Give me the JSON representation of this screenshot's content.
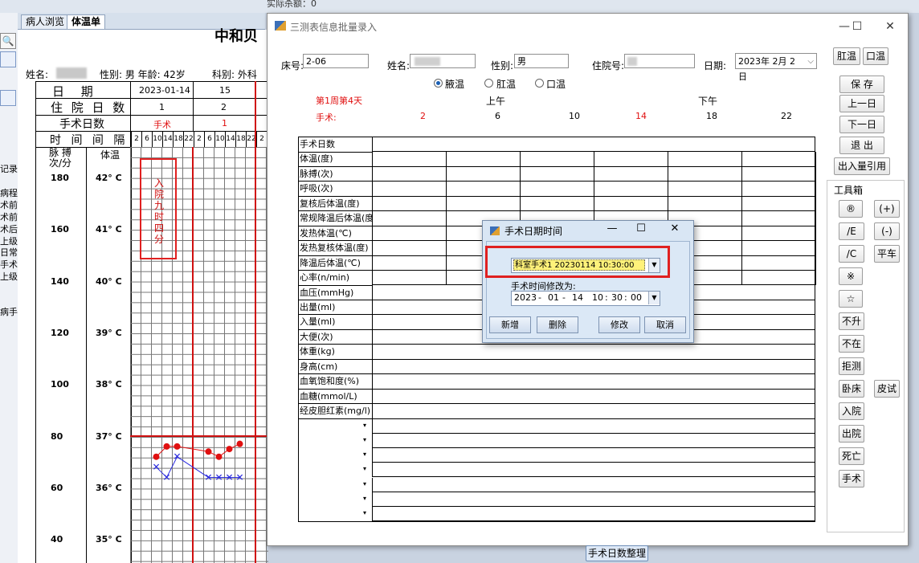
{
  "bg_app": {
    "top_text": "实际杀额：0",
    "pin_label": "中",
    "tabs": [
      "病人浏览",
      "体温单"
    ],
    "sheet_title": "中和贝",
    "left_fragments": [
      "记录",
      "病程",
      "术前",
      "术前",
      "术后",
      "上级",
      "日常",
      "手术",
      "上级",
      "病手"
    ],
    "patient": {
      "name_label": "姓名:",
      "sex_age": "性别: 男 年龄: 42岁",
      "dept": "科别: 外科"
    },
    "header_rows": {
      "date_label": "日 期",
      "date_values": [
        "2023-01-14",
        "15"
      ],
      "days_label": "住 院 日 数",
      "days_values": [
        "1",
        "2"
      ],
      "op_label": "手术日数",
      "op_values": [
        "手术",
        "1"
      ],
      "interval_label": "时 间 间 隔",
      "interval_values": [
        "2",
        "6",
        "10",
        "14",
        "18",
        "22",
        "2",
        "6",
        "10",
        "14",
        "18",
        "22",
        "2"
      ]
    },
    "axis": {
      "pulse_label": "脉 搏\n次/分",
      "temp_label": "体温",
      "pulse_ticks": [
        "180",
        "160",
        "140",
        "120",
        "100",
        "80",
        "60",
        "40"
      ],
      "temp_ticks": [
        "42° C",
        "41° C",
        "40° C",
        "39° C",
        "38° C",
        "37° C",
        "36° C",
        "35° C"
      ]
    },
    "admission_note": [
      "入",
      "院",
      "九",
      "时",
      "四",
      "分"
    ],
    "series_temp_red": [
      {
        "slot": 2,
        "value": 36.6
      },
      {
        "slot": 3,
        "value": 36.8
      },
      {
        "slot": 4,
        "value": 36.8
      },
      {
        "slot": 7,
        "value": 36.7
      },
      {
        "slot": 8,
        "value": 36.6
      },
      {
        "slot": 9,
        "value": 36.75
      },
      {
        "slot": 10,
        "value": 36.85
      }
    ],
    "series_pulse_blue": [
      {
        "slot": 2,
        "value": 36.4
      },
      {
        "slot": 3,
        "value": 36.2
      },
      {
        "slot": 4,
        "value": 36.6
      },
      {
        "slot": 7,
        "value": 36.2
      },
      {
        "slot": 8,
        "value": 36.2
      },
      {
        "slot": 9,
        "value": 36.2
      },
      {
        "slot": 10,
        "value": 36.2
      }
    ],
    "footer_button": "手术日数整理"
  },
  "main_dialog": {
    "title": "三测表信息批量录入",
    "window_controls": {
      "min": "—",
      "max": "☐",
      "close": "✕"
    },
    "fields": {
      "bed_label": "床号:",
      "bed_value": "2-06",
      "name_label": "姓名:",
      "name_value": "",
      "sex_label": "性别:",
      "sex_value": "男",
      "inpatient_label": "住院号:",
      "inpatient_value": "",
      "date_label": "日期:",
      "date_value": "2023年 2月 2日"
    },
    "temp_buttons": [
      "肛温",
      "口温"
    ],
    "radios": [
      {
        "label": "腋温",
        "checked": true
      },
      {
        "label": "肛温",
        "checked": false
      },
      {
        "label": "口温",
        "checked": false
      }
    ],
    "week_info": "第1周第4天",
    "am_label": "上午",
    "pm_label": "下午",
    "op_label": "手术:",
    "hours": [
      {
        "h": "2",
        "red": true
      },
      {
        "h": "6",
        "red": false
      },
      {
        "h": "10",
        "red": false
      },
      {
        "h": "14",
        "red": true
      },
      {
        "h": "18",
        "red": false
      },
      {
        "h": "22",
        "red": false
      }
    ],
    "row_labels": [
      "手术日数",
      "体温(度)",
      "脉搏(次)",
      "呼吸(次)",
      "复核后体温(度)",
      "常规降温后体温(度)",
      "发热体温(℃)",
      "发热复核体温(度)",
      "降温后体温(℃)",
      "心率(n/min)",
      "血压(mmHg)",
      "出量(ml)",
      "入量(ml)",
      "大便(次)",
      "体重(kg)",
      "身高(cm)",
      "血氧饱和度(%)",
      "血糖(mmol/L)",
      "经皮胆红素(mg/l)"
    ],
    "right_buttons": [
      "保 存",
      "上一日",
      "下一日",
      "退 出",
      "出入量引用"
    ],
    "toolbox_label": "工具箱",
    "tools": [
      [
        "®",
        "(+)"
      ],
      [
        "/E",
        "(-)"
      ],
      [
        "/C",
        "平车"
      ],
      [
        "※",
        ""
      ],
      [
        "☆",
        ""
      ],
      [
        "不升",
        ""
      ],
      [
        "不在",
        ""
      ],
      [
        "拒测",
        ""
      ],
      [
        "卧床",
        "皮试"
      ],
      [
        "入院",
        ""
      ],
      [
        "出院",
        ""
      ],
      [
        "死亡",
        ""
      ],
      [
        "手术",
        ""
      ]
    ]
  },
  "surgery_dialog": {
    "title": "手术日期时间",
    "window_controls": {
      "min": "—",
      "max": "☐",
      "close": "✕"
    },
    "selected_item": "科室手术1 20230114 10:30:00",
    "modify_label": "手术时间修改为:",
    "new_time": {
      "year": "2023",
      "month": "01",
      "day": "14",
      "hour": "10",
      "minute": "30",
      "second": "00"
    },
    "buttons": [
      "新增",
      "删除",
      "修改",
      "取消"
    ]
  },
  "colors": {
    "accent_red": "#e01010",
    "highlight_box": "#e02020",
    "selection_yellow": "#fff27a",
    "dialog_blue": "#d9e6f4",
    "pulse_blue": "#2a2adf"
  }
}
